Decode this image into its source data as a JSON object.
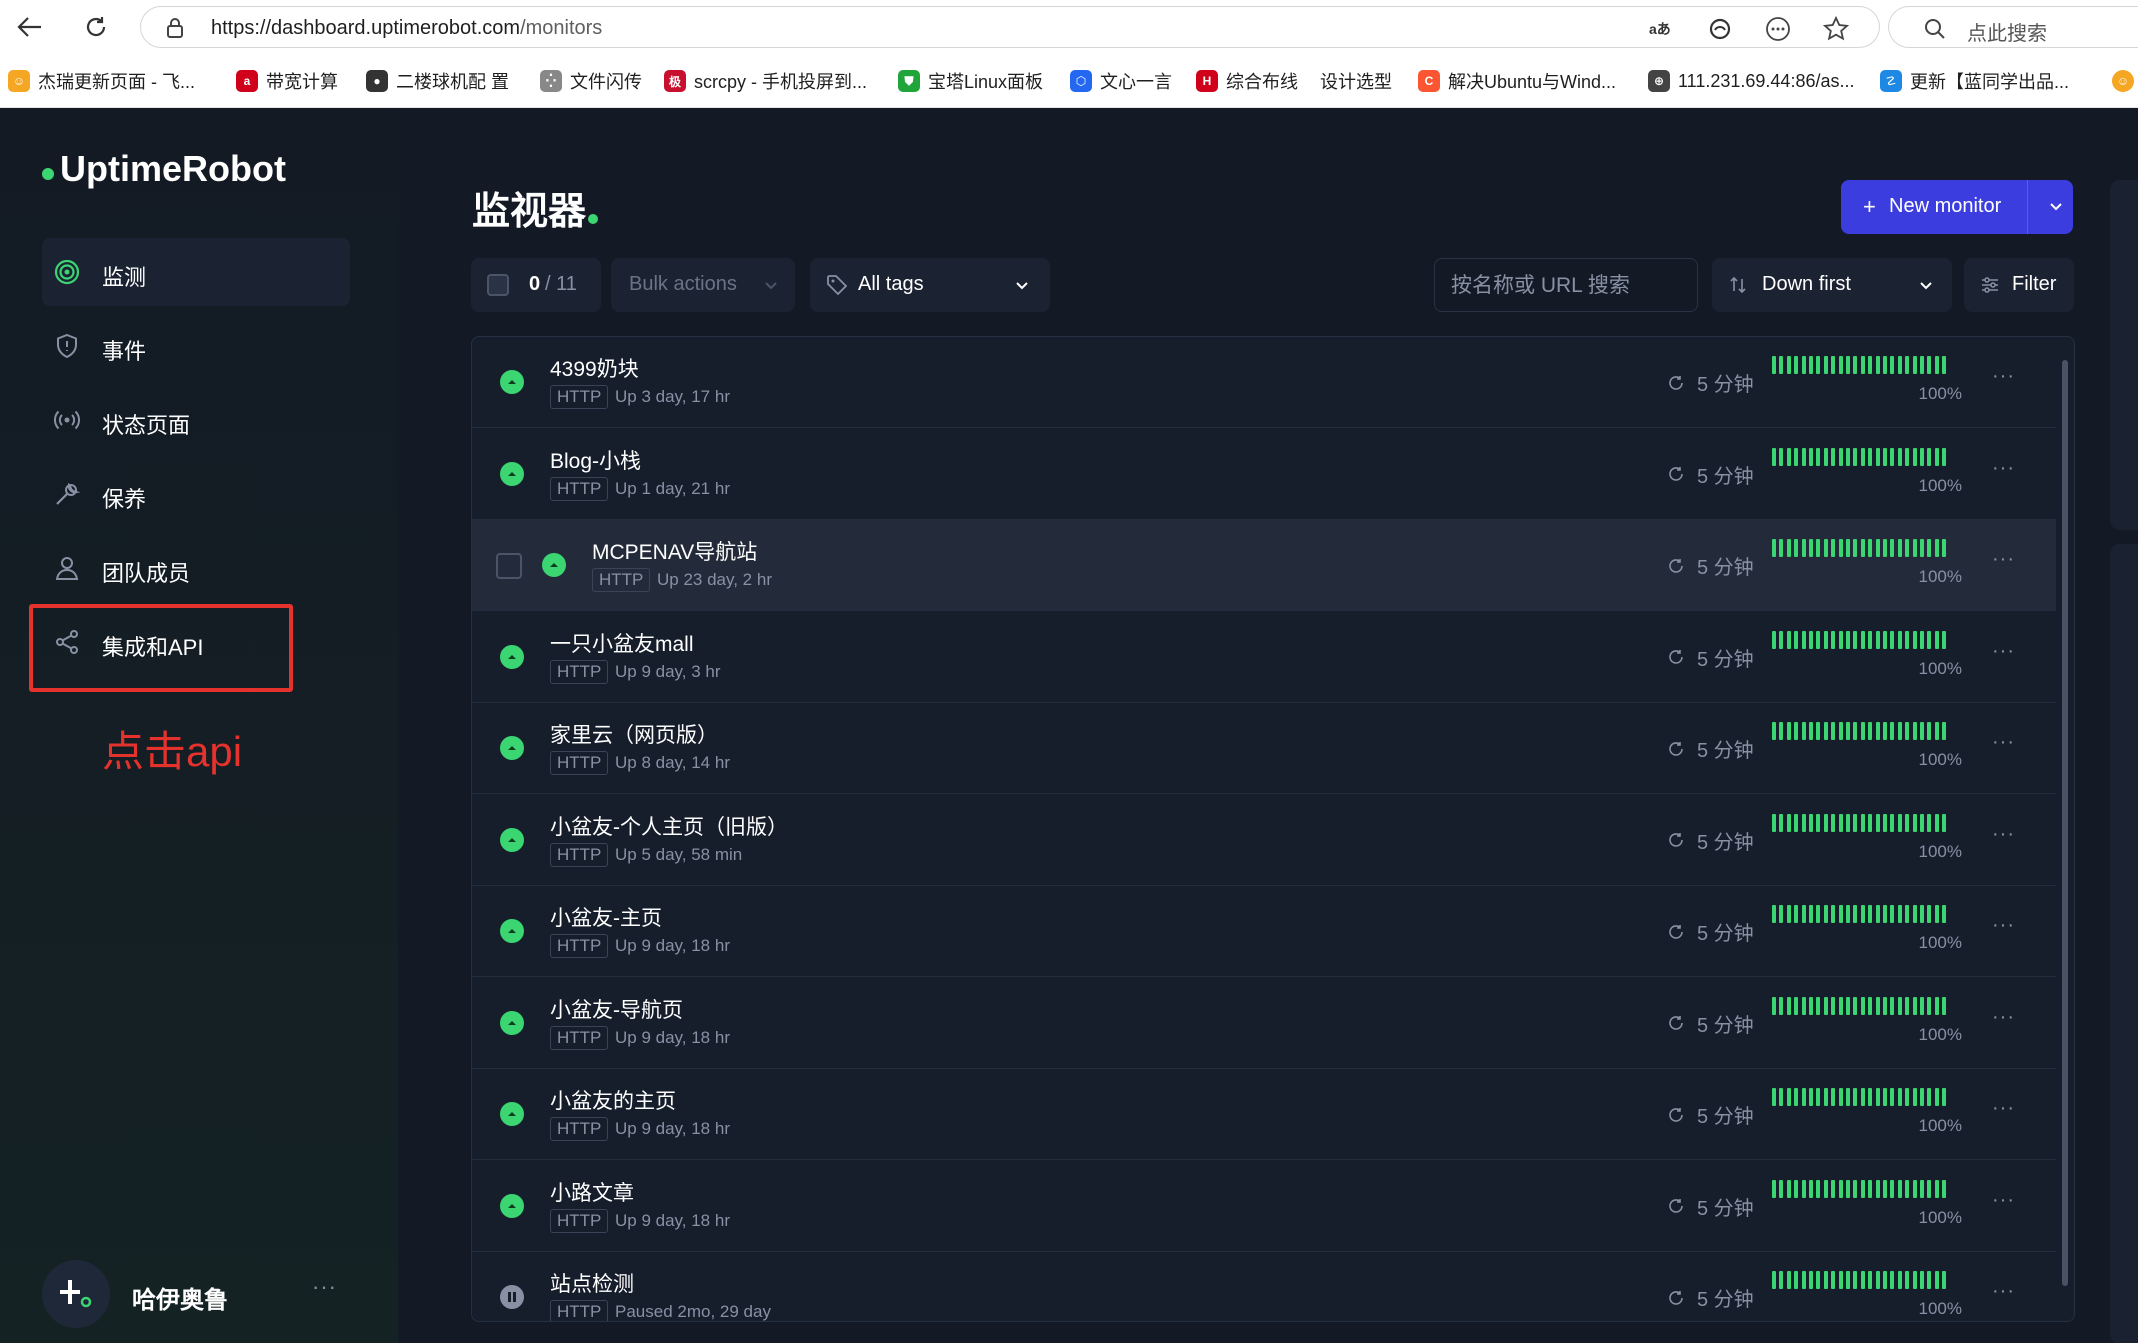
{
  "browser": {
    "url_host": "https://dashboard.uptimerobot.com",
    "url_path": "/monitors",
    "search_placeholder": "点此搜索",
    "bookmarks": [
      {
        "label": "杰瑞更新页面 - 飞...",
        "color": "#f5a623",
        "glyph": "☺"
      },
      {
        "label": "带宽计算",
        "color": "#d0021b",
        "glyph": "a"
      },
      {
        "label": "二楼球机配 置",
        "color": "#333333",
        "glyph": "●"
      },
      {
        "label": "文件闪传",
        "color": "#888888",
        "glyph": "⁛"
      },
      {
        "label": "scrcpy - 手机投屏到...",
        "color": "#c8102e",
        "glyph": "极"
      },
      {
        "label": "宝塔Linux面板",
        "color": "#20a53a",
        "glyph": "⛊"
      },
      {
        "label": "文心一言",
        "color": "#2468f2",
        "glyph": "⬡"
      },
      {
        "label": "综合布线",
        "color": "#d0021b",
        "glyph": "H"
      },
      {
        "label": "设计选型",
        "color": "",
        "glyph": ""
      },
      {
        "label": "解决Ubuntu与Wind...",
        "color": "#fc5531",
        "glyph": "C"
      },
      {
        "label": "111.231.69.44:86/as...",
        "color": "#444444",
        "glyph": "⊕"
      },
      {
        "label": "更新【蓝同学出品...",
        "color": "#1e88e5",
        "glyph": "☡"
      }
    ]
  },
  "sidebar": {
    "logo": "UptimeRobot",
    "items": [
      {
        "label": "监测",
        "icon": "target-icon",
        "active": true
      },
      {
        "label": "事件",
        "icon": "shield-icon",
        "active": false
      },
      {
        "label": "状态页面",
        "icon": "broadcast-icon",
        "active": false
      },
      {
        "label": "保养",
        "icon": "wrench-icon",
        "active": false
      },
      {
        "label": "团队成员",
        "icon": "user-icon",
        "active": false
      },
      {
        "label": "集成和API",
        "icon": "share-icon",
        "active": false
      }
    ],
    "annotation": "点击api",
    "user_name": "哈伊奥鲁",
    "user_more": "···"
  },
  "main": {
    "title": "监视器",
    "new_monitor": "New monitor",
    "selection_count": "0",
    "selection_total": "/ 11",
    "bulk_actions": "Bulk actions",
    "all_tags": "All tags",
    "search_placeholder": "按名称或 URL 搜索",
    "sort": "Down first",
    "filter": "Filter"
  },
  "colors": {
    "accent": "#3b3dde",
    "up": "#3bd671",
    "paused": "#8891a4",
    "annotation": "#e5322d"
  },
  "monitors": [
    {
      "name": "4399奶块",
      "type": "HTTP",
      "uptime": "Up 3 day, 17 hr",
      "interval": "5 分钟",
      "pct": "100%",
      "status": "up"
    },
    {
      "name": "Blog-小栈",
      "type": "HTTP",
      "uptime": "Up 1 day, 21 hr",
      "interval": "5 分钟",
      "pct": "100%",
      "status": "up"
    },
    {
      "name": "MCPENAV导航站",
      "type": "HTTP",
      "uptime": "Up 23 day, 2 hr",
      "interval": "5 分钟",
      "pct": "100%",
      "status": "up"
    },
    {
      "name": "一只小盆友mall",
      "type": "HTTP",
      "uptime": "Up 9 day, 3 hr",
      "interval": "5 分钟",
      "pct": "100%",
      "status": "up"
    },
    {
      "name": "家里云（网页版）",
      "type": "HTTP",
      "uptime": "Up 8 day, 14 hr",
      "interval": "5 分钟",
      "pct": "100%",
      "status": "up"
    },
    {
      "name": "小盆友-个人主页（旧版）",
      "type": "HTTP",
      "uptime": "Up 5 day, 58 min",
      "interval": "5 分钟",
      "pct": "100%",
      "status": "up"
    },
    {
      "name": "小盆友-主页",
      "type": "HTTP",
      "uptime": "Up 9 day, 18 hr",
      "interval": "5 分钟",
      "pct": "100%",
      "status": "up"
    },
    {
      "name": "小盆友-导航页",
      "type": "HTTP",
      "uptime": "Up 9 day, 18 hr",
      "interval": "5 分钟",
      "pct": "100%",
      "status": "up"
    },
    {
      "name": "小盆友的主页",
      "type": "HTTP",
      "uptime": "Up 9 day, 18 hr",
      "interval": "5 分钟",
      "pct": "100%",
      "status": "up"
    },
    {
      "name": "小路文章",
      "type": "HTTP",
      "uptime": "Up 9 day, 18 hr",
      "interval": "5 分钟",
      "pct": "100%",
      "status": "up"
    },
    {
      "name": "站点检测",
      "type": "HTTP",
      "uptime": "Paused 2mo, 29 day",
      "interval": "5 分钟",
      "pct": "100%",
      "status": "paused"
    }
  ]
}
